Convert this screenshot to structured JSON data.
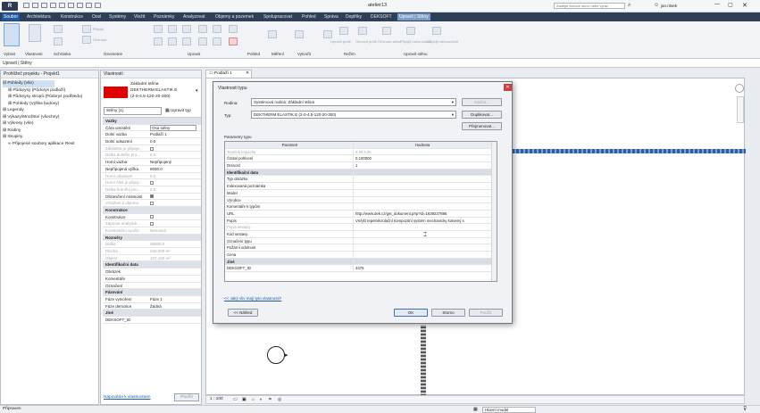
{
  "window": {
    "title": "atelier13",
    "search_placeholder": "Zadejte klíčové slovo nebo výraz",
    "user": "jan.ritsek"
  },
  "ribbon_tabs": [
    "Soubor",
    "Architektura",
    "Konstrukce",
    "Ocel",
    "Systémy",
    "Vložit",
    "Poznámky",
    "Analyzovat",
    "Objemy a pozemek",
    "Spolupracovat",
    "Pohled",
    "Správa",
    "Doplňky",
    "DEKSOFT",
    "Upravit | Stěny"
  ],
  "ribbon_groups": [
    "Vybrat",
    "Vlastnosti",
    "Schránka",
    "Geometrie",
    "Upravit",
    "Pohled",
    "Měření",
    "Vytvořit",
    "Režim",
    "Upravit stěnu"
  ],
  "ribbon_buttons": [
    "Připojit",
    "Oříznout",
    "Upravit profil",
    "Obnovit profil",
    "Oříznout stěnu",
    "Připojit nahoru/dolů",
    "Odpojit nahoru/dolů"
  ],
  "option_bar": {
    "label": "Upravit | Stěny"
  },
  "project_browser": {
    "title": "Prohlížeč projektu - Projekt1",
    "items": [
      "Pohledy (vše)",
      "Půdorysy (Půdorys podlaží)",
      "Půdorysy stropů (Půdorys podhledu)",
      "Pohledy (Výška budovy)",
      "Legendy",
      "Výkazy/Množství (všechny)",
      "Výkresy (vše)",
      "Rodiny",
      "Skupiny",
      "Připojené soubory aplikace Revit"
    ]
  },
  "properties": {
    "title": "Vlastnosti",
    "type_family": "Základní stěna",
    "type_name": "DEKTHERM ELASTIK E",
    "type_code": "(2-0-4.5-120-20-300)",
    "selector": "Stěny (1)",
    "edit_type": "Upravit typ",
    "rows": [
      {
        "k": "Vazby",
        "v": "",
        "sec": true
      },
      {
        "k": "Čára umístění",
        "v": "Osa stěny"
      },
      {
        "k": "Dolní vazba",
        "v": "Podlaží 1"
      },
      {
        "k": "Dolní odsazení",
        "v": "0.0"
      },
      {
        "k": "Základna je připoje...",
        "v": "",
        "grey": true
      },
      {
        "k": "Délka dolního pro...",
        "v": "0.0",
        "grey": true
      },
      {
        "k": "Horní vazba",
        "v": "Nepřipojený"
      },
      {
        "k": "Nepřipojená výška",
        "v": "8000.0"
      },
      {
        "k": "Horní odsazení",
        "v": "0.0",
        "grey": true
      },
      {
        "k": "Horní část je připoj...",
        "v": "",
        "grey": true
      },
      {
        "k": "Délka horního pro...",
        "v": "0.0",
        "grey": true
      },
      {
        "k": "Ohraničení místností",
        "v": ""
      },
      {
        "k": "Vztažení k objemu",
        "v": "",
        "grey": true
      },
      {
        "k": "Konstrukce",
        "v": "",
        "sec": true
      },
      {
        "k": "Konstrukce",
        "v": ""
      },
      {
        "k": "Zapnout analytick...",
        "v": "",
        "grey": true
      },
      {
        "k": "Konstrukční využití",
        "v": "Nenosná",
        "grey": true
      },
      {
        "k": "Rozměry",
        "v": "",
        "sec": true
      },
      {
        "k": "Délka",
        "v": "30000.0",
        "grey": true
      },
      {
        "k": "Plocha",
        "v": "240.000 m²",
        "grey": true
      },
      {
        "k": "Objem",
        "v": "107.160 m³",
        "grey": true
      },
      {
        "k": "Identifikační data",
        "v": "",
        "sec": true
      },
      {
        "k": "Obrázek",
        "v": ""
      },
      {
        "k": "Komentáře",
        "v": ""
      },
      {
        "k": "Označení",
        "v": ""
      },
      {
        "k": "Fázování",
        "v": "",
        "sec": true
      },
      {
        "k": "Fáze vytvoření",
        "v": "Fáze 1"
      },
      {
        "k": "Fáze demolice",
        "v": "Žádná"
      },
      {
        "k": "Jiné",
        "v": "",
        "sec": true
      },
      {
        "k": "DEKSOFT_ID",
        "v": ""
      }
    ],
    "help_link": "Nápověda k vlastnostem",
    "apply": "Použít"
  },
  "view_tab": {
    "label": "Podlaží 1"
  },
  "dialog": {
    "title": "Vlastnosti typu",
    "family_label": "Rodina:",
    "family_value": "Systémová rodina: Základní stěna",
    "type_label": "Typ:",
    "type_value": "DEKTHERM ELASTIK E (2-0-4.5-120-20-300)",
    "load": "Načíst...",
    "duplicate": "Duplikovat...",
    "rename": "Přejmenovat...",
    "params_label": "Parametry typu",
    "col_param": "Parametr",
    "col_value": "Hodnota",
    "rows": [
      {
        "k": "Tepelná kapacita",
        "v": "8.58 kJ/K",
        "grey": true
      },
      {
        "k": "Činitel pohlcení",
        "v": "0.100000"
      },
      {
        "k": "Drsnost",
        "v": "1"
      },
      {
        "k": "Identifikační data",
        "v": "",
        "sec": true
      },
      {
        "k": "Typ obrázku",
        "v": ""
      },
      {
        "k": "Indexovaná poznámka",
        "v": ""
      },
      {
        "k": "Model",
        "v": ""
      },
      {
        "k": "Výrobce",
        "v": ""
      },
      {
        "k": "Komentáře k typům",
        "v": ""
      },
      {
        "k": "URL",
        "v": "http://www.dek.cz/get_dokument.php?id=1639237886"
      },
      {
        "k": "Popis",
        "v": "Vnější tepelněizolační kompozitní systém mechanicky kotvený s"
      },
      {
        "k": "Popis sestavy",
        "v": "",
        "grey": true
      },
      {
        "k": "Kód sestavy",
        "v": ""
      },
      {
        "k": "Označení typu",
        "v": ""
      },
      {
        "k": "Požární odolnost",
        "v": ""
      },
      {
        "k": "Cena",
        "v": ""
      },
      {
        "k": "Jiné",
        "v": "",
        "sec": true
      },
      {
        "k": "DEKSOFT_ID",
        "v": "4475"
      }
    ],
    "help_link": "<< Jaký vliv mají tyto vlastnosti?",
    "preview": "<< Náhled",
    "ok": "OK",
    "cancel": "Storno",
    "apply": "Použít"
  },
  "view_controls": {
    "scale": "1 : 100"
  },
  "status_bar": {
    "left": "Připraven",
    "model": "Hlavní model"
  },
  "colors": {
    "ribbon_tab_bg": "#2e3f56",
    "context_tab": "#7a9cc4",
    "swatch": "#e00000",
    "wall_line": "#2c5fa8"
  }
}
